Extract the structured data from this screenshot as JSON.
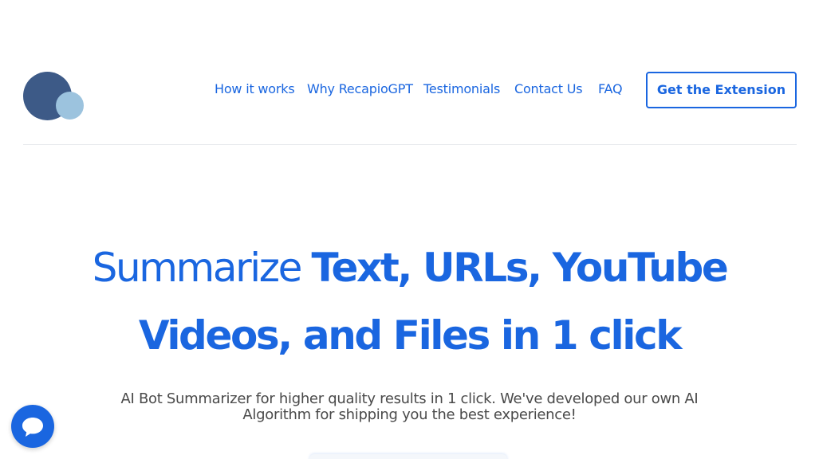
{
  "nav": {
    "items": [
      {
        "label": "How it works"
      },
      {
        "label": "Why RecapioGPT"
      },
      {
        "label": "Testimonials"
      },
      {
        "label": "Contact Us"
      },
      {
        "label": "FAQ"
      }
    ],
    "cta_label": "Get the Extension"
  },
  "hero": {
    "headline_light": "Summarize ",
    "headline_bold_1": "Text, URLs, YouTube",
    "headline_bold_2": "Videos, and Files in 1 click",
    "subheadline": "AI Bot Summarizer for higher quality results in 1 click.  We've developed our own AI Algorithm for shipping you the best experience!"
  },
  "colors": {
    "accent": "#1a66e0",
    "logo_dark": "#3d5a87",
    "logo_light": "#9cc3de"
  },
  "icons": {
    "logo": "recapio-logo",
    "chat": "chat-bubble-icon"
  }
}
